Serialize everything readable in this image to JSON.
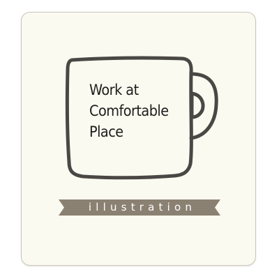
{
  "card": {
    "background": "#fbfaf0",
    "border_color": "#c9c6bc"
  },
  "mug": {
    "icon": "coffee-mug-icon",
    "stroke_color": "#4a4744",
    "lines": [
      "Work at",
      "Comfortable",
      "Place"
    ]
  },
  "ribbon": {
    "label": "illustration",
    "color": "#8b8172"
  }
}
